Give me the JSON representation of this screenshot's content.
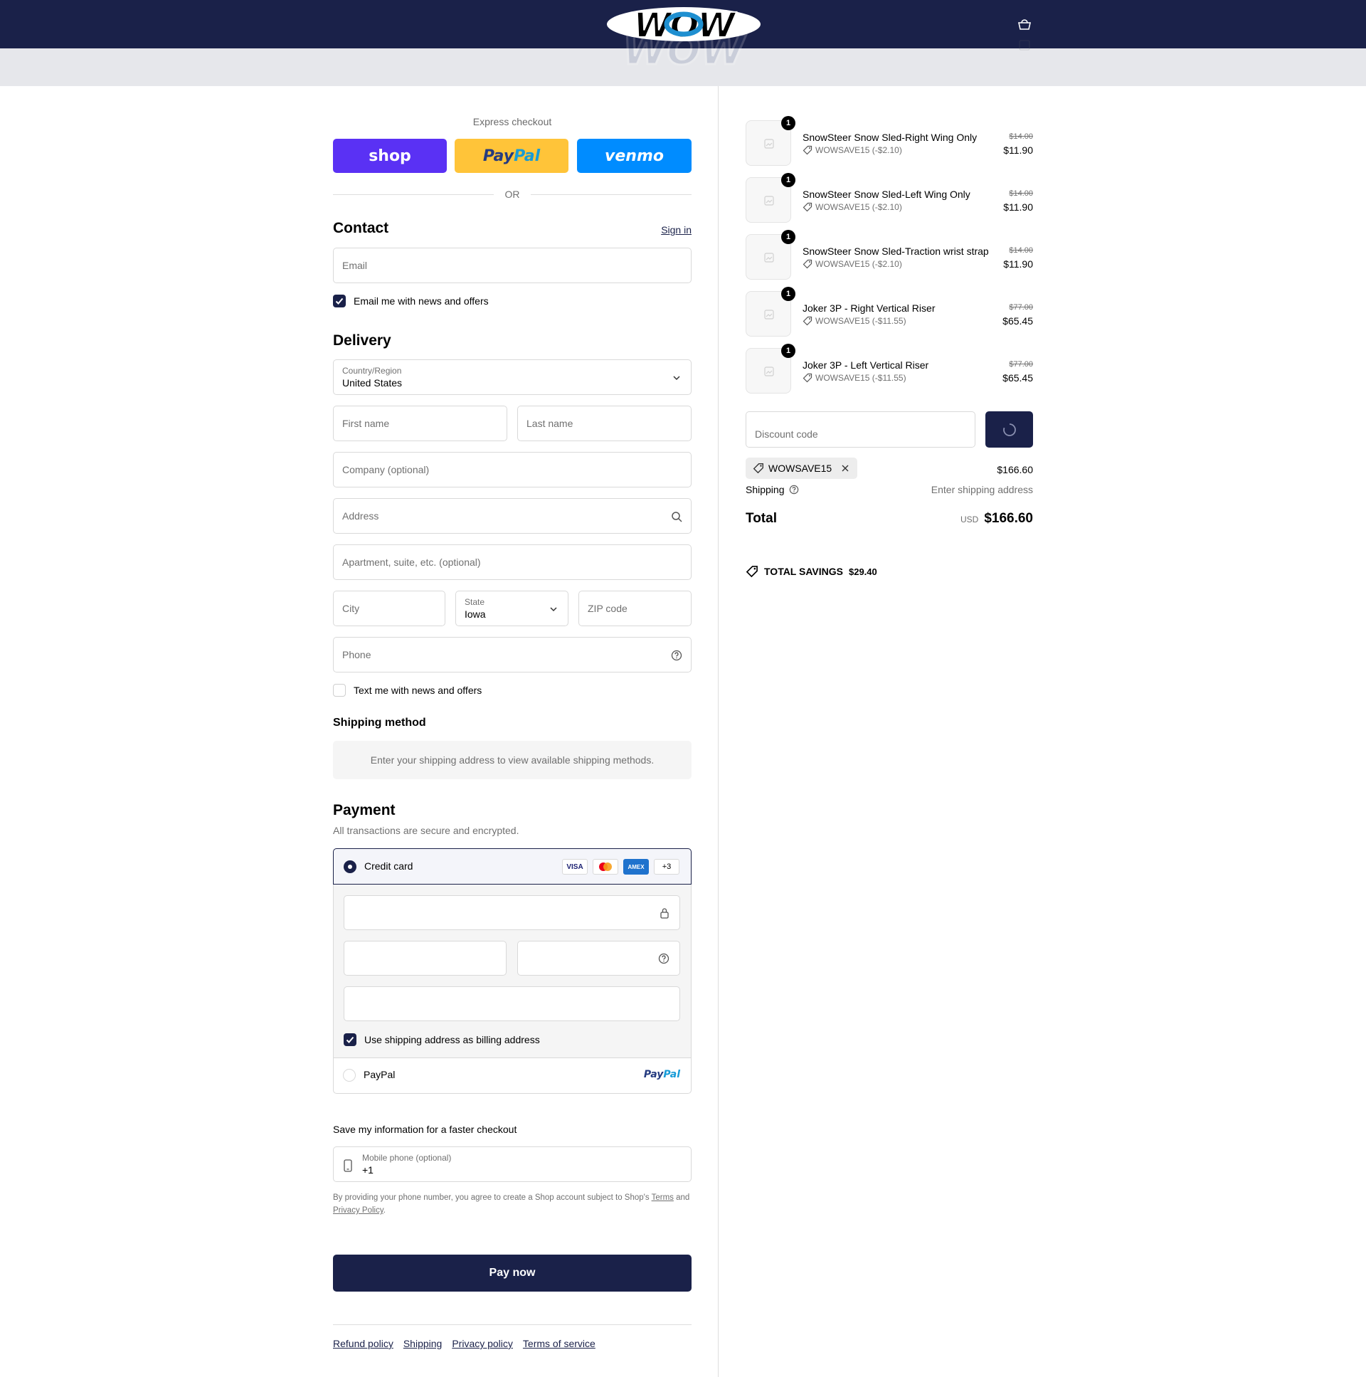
{
  "header": {
    "logo_text": "WOW",
    "cart_icon": "bag-icon"
  },
  "colors": {
    "brand_navy": "#1a2149",
    "shop_purple": "#5a31f4",
    "paypal_yellow": "#ffc439",
    "venmo_blue": "#008cff"
  },
  "express": {
    "label": "Express checkout",
    "shop_label": "shop",
    "paypal_label_1": "Pay",
    "paypal_label_2": "Pal",
    "venmo_label": "venmo",
    "or_label": "OR"
  },
  "contact": {
    "title": "Contact",
    "sign_in": "Sign in",
    "email_placeholder": "Email",
    "news_label": "Email me with news and offers"
  },
  "delivery": {
    "title": "Delivery",
    "country_label": "Country/Region",
    "country_value": "United States",
    "first_name": "First name",
    "last_name": "Last name",
    "company": "Company (optional)",
    "address": "Address",
    "apartment": "Apartment, suite, etc. (optional)",
    "city": "City",
    "state_label": "State",
    "state_value": "Iowa",
    "zip": "ZIP code",
    "phone": "Phone",
    "text_label": "Text me with news and offers"
  },
  "shipping_method": {
    "title": "Shipping method",
    "notice": "Enter your shipping address to view available shipping methods."
  },
  "payment": {
    "title": "Payment",
    "subtitle": "All transactions are secure and encrypted.",
    "credit_card": "Credit card",
    "badges": [
      "VISA",
      "",
      "AMEX",
      "+3"
    ],
    "billing_label": "Use shipping address as billing address",
    "paypal": "PayPal",
    "paypal_logo_1": "Pay",
    "paypal_logo_2": "Pal"
  },
  "save_info": {
    "title": "Save my information for a faster checkout",
    "mobile_label": "Mobile phone (optional)",
    "mobile_value": "+1",
    "fine_1": "By providing your phone number, you agree to create a Shop account subject to Shop's",
    "terms": "Terms",
    "fine_and": "and",
    "privacy": "Privacy Policy",
    "fine_end": "."
  },
  "pay_now": "Pay now",
  "footer": {
    "links": [
      "Refund policy",
      "Shipping",
      "Privacy policy",
      "Terms of service"
    ]
  },
  "summary": {
    "items": [
      {
        "qty": "1",
        "name": "SnowSteer Snow Sled-Right Wing Only",
        "discount": "WOWSAVE15 (-$2.10)",
        "original": "$14.00",
        "price": "$11.90"
      },
      {
        "qty": "1",
        "name": "SnowSteer Snow Sled-Left Wing Only",
        "discount": "WOWSAVE15 (-$2.10)",
        "original": "$14.00",
        "price": "$11.90"
      },
      {
        "qty": "1",
        "name": "SnowSteer Snow Sled-Traction wrist strap",
        "discount": "WOWSAVE15 (-$2.10)",
        "original": "$14.00",
        "price": "$11.90"
      },
      {
        "qty": "1",
        "name": "Joker 3P - Right Vertical Riser",
        "discount": "WOWSAVE15 (-$11.55)",
        "original": "$77.00",
        "price": "$65.45"
      },
      {
        "qty": "1",
        "name": "Joker 3P - Left Vertical Riser",
        "discount": "WOWSAVE15 (-$11.55)",
        "original": "$77.00",
        "price": "$65.45"
      }
    ],
    "discount_placeholder": "Discount code",
    "applied_code": "WOWSAVE15",
    "subtotal": "$166.60",
    "shipping_label": "Shipping",
    "shipping_value": "Enter shipping address",
    "total_label": "Total",
    "currency": "USD",
    "total_value": "$166.60",
    "savings_label": "TOTAL SAVINGS",
    "savings_value": "$29.40"
  }
}
